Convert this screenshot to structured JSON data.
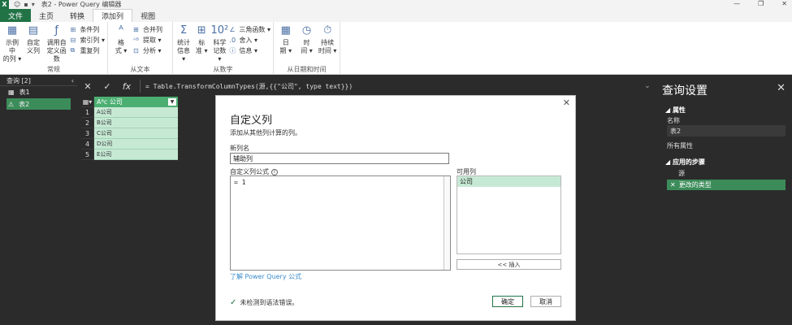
{
  "titlebar": {
    "app_logo": "X",
    "title": "表2 - Power Query 编辑器",
    "minimize": "—",
    "restore": "❐",
    "close": "✕"
  },
  "tabs": [
    {
      "label": "文件"
    },
    {
      "label": "主页"
    },
    {
      "label": "转换"
    },
    {
      "label": "添加列"
    },
    {
      "label": "视图"
    }
  ],
  "ribbon": {
    "general": {
      "label": "常规",
      "example_col": "示例中\n的列 ▾",
      "custom_col": "自定\n义列",
      "invoke_func": "调用自\n定义函数",
      "conditional_col": "条件列",
      "index_col": "索引列 ▾",
      "duplicate_col": "重复列"
    },
    "text": {
      "label": "从文本",
      "format": "格\n式 ▾",
      "merge_cols": "合并列",
      "extract": "提取 ▾",
      "parse": "分析 ▾"
    },
    "number": {
      "label": "从数字",
      "statistics": "统计\n信息 ▾",
      "standard": "标\n准 ▾",
      "scientific": "科学\n记数 ▾",
      "trigonometry": "三角函数 ▾",
      "rounding": "舍入 ▾",
      "info": "信息 ▾"
    },
    "datetime": {
      "label": "从日期和时间",
      "date": "日\n期 ▾",
      "time": "时\n间 ▾",
      "duration": "持续\n时间 ▾"
    }
  },
  "leftpane": {
    "header": "查询 [2]",
    "items": [
      {
        "label": "表1"
      },
      {
        "label": "表2"
      }
    ]
  },
  "formulabar": {
    "cancel": "✕",
    "commit": "✓",
    "fx": "fx",
    "formula": "= Table.TransformColumnTypes(源,{{\"公司\", type text}})"
  },
  "grid": {
    "header": "公司",
    "type_icon": "Aᴮc",
    "rows": [
      {
        "num": "1",
        "value": "A公司"
      },
      {
        "num": "2",
        "value": "B公司"
      },
      {
        "num": "3",
        "value": "C公司"
      },
      {
        "num": "4",
        "value": "D公司"
      },
      {
        "num": "5",
        "value": "E公司"
      }
    ]
  },
  "settings": {
    "title": "查询设置",
    "props_section": "属性",
    "name_label": "名称",
    "name_value": "表2",
    "all_props": "所有属性",
    "steps_section": "应用的步骤",
    "steps": [
      {
        "label": "源"
      },
      {
        "label": "更改的类型"
      }
    ]
  },
  "dialog": {
    "title": "自定义列",
    "subtitle": "添加从其他列计算的列。",
    "new_col_label": "新列名",
    "new_col_value": "辅助列",
    "formula_label": "自定义列公式",
    "formula_value": "= 1",
    "available_label": "可用列",
    "available": [
      {
        "label": "公司"
      }
    ],
    "insert": "<< 插入",
    "learn_link": "了解 Power Query 公式",
    "status": "未检测到语法错误。",
    "ok": "确定",
    "cancel": "取消"
  }
}
